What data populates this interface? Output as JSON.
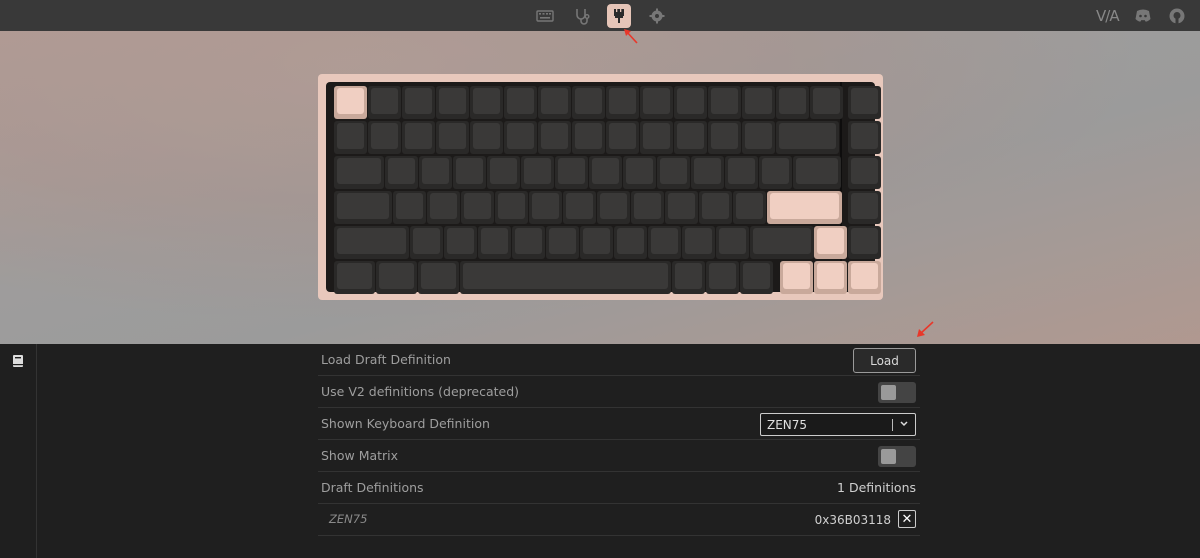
{
  "nav": {
    "icons": [
      "keyboard-icon",
      "stethoscope-icon",
      "paintbrush-icon",
      "gear-icon"
    ],
    "active": "paintbrush-icon",
    "brand": "V/A",
    "right_icons": [
      "discord-icon",
      "github-icon"
    ]
  },
  "keyboard": {
    "highlighted_keys": [
      "esc",
      "enter",
      "up-arrow",
      "left-arrow",
      "down-arrow",
      "right-arrow"
    ]
  },
  "settings": {
    "load_draft_label": "Load Draft Definition",
    "load_button": "Load",
    "use_v2_label": "Use V2 definitions (deprecated)",
    "use_v2_on": false,
    "shown_def_label": "Shown Keyboard Definition",
    "shown_def_value": "ZEN75",
    "show_matrix_label": "Show Matrix",
    "show_matrix_on": false,
    "draft_defs_label": "Draft Definitions",
    "draft_defs_count": "1 Definitions",
    "draft_item_name": "ZEN75",
    "draft_item_id": "0x36B03118",
    "close_glyph": "✕"
  },
  "colors": {
    "accent": "#e6c5b8",
    "annotation": "#e8372a"
  }
}
